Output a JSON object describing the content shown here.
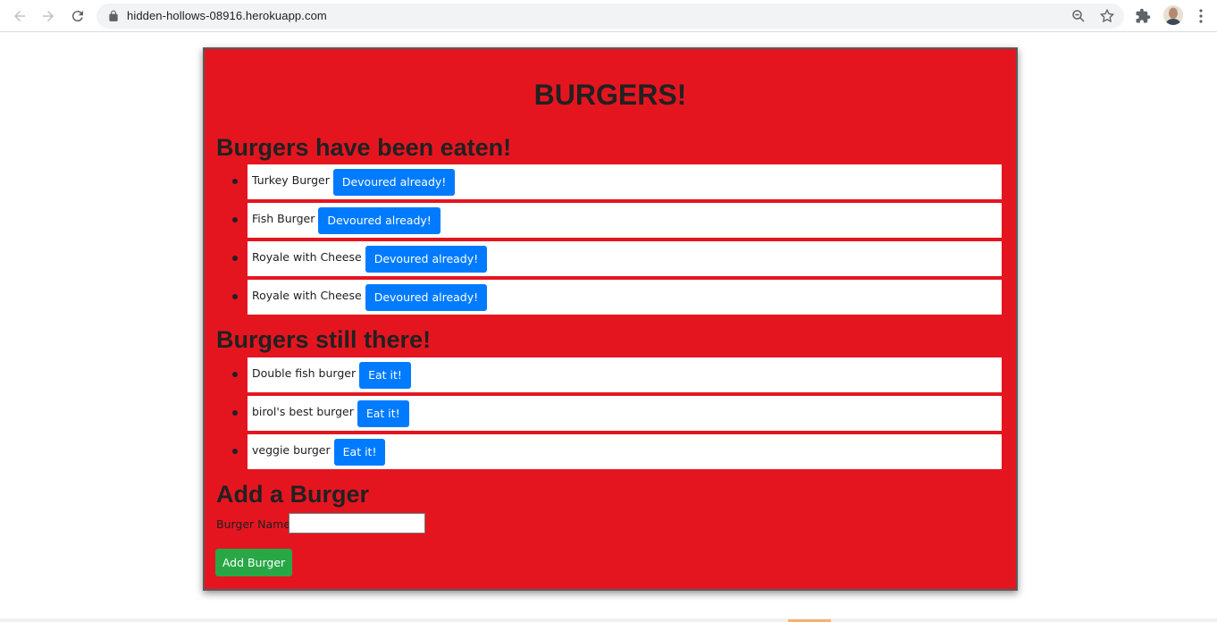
{
  "browser": {
    "url": "hidden-hollows-08916.herokuapp.com"
  },
  "page": {
    "title": "BURGERS!",
    "eaten_heading": "Burgers have been eaten!",
    "eaten": [
      {
        "name": "Turkey Burger",
        "button": "Devoured already!"
      },
      {
        "name": "Fish Burger",
        "button": "Devoured already!"
      },
      {
        "name": "Royale with Cheese",
        "button": "Devoured already!"
      },
      {
        "name": "Royale with Cheese",
        "button": "Devoured already!"
      }
    ],
    "remaining_heading": "Burgers still there!",
    "remaining": [
      {
        "name": "Double fish burger",
        "button": "Eat it!"
      },
      {
        "name": "birol's best burger",
        "button": "Eat it!"
      },
      {
        "name": "veggie burger",
        "button": "Eat it!"
      }
    ],
    "add_heading": "Add a Burger",
    "form_label": "Burger Name:",
    "form_value": "",
    "add_button": "Add Burger"
  },
  "colors": {
    "panel_bg": "#e51520",
    "button_blue": "#007bff",
    "button_green": "#28a745"
  }
}
